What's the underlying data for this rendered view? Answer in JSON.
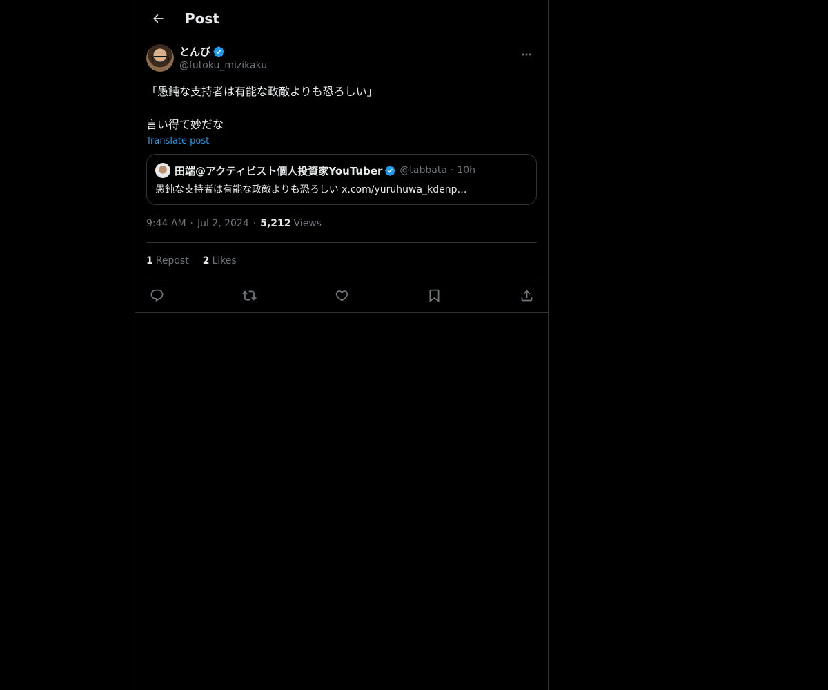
{
  "header": {
    "title": "Post",
    "back_icon": "arrow-left-icon"
  },
  "post": {
    "author": {
      "display_name": "とんび",
      "handle": "@futoku_mizikaku",
      "verified": true
    },
    "text_line1": "「愚鈍な支持者は有能な政敵よりも恐ろしい」",
    "text_line2": "言い得て妙だな",
    "translate_label": "Translate post",
    "quote": {
      "display_name": "田端@アクティビスト個人投資家YouTuber",
      "handle": "@tabbata",
      "dot": "·",
      "time": "10h",
      "body": "愚鈍な支持者は有能な政敵よりも恐ろしい x.com/yuruhuwa_kdenp…"
    },
    "time": "9:44 AM",
    "date": "Jul 2, 2024",
    "sep": "·",
    "views_count": "5,212",
    "views_label": "Views",
    "reposts_count": "1",
    "reposts_label": "Repost",
    "likes_count": "2",
    "likes_label": "Likes"
  },
  "colors": {
    "accent": "#1d9bf0",
    "background": "#000000",
    "muted": "#71767b",
    "border": "#2f3336"
  }
}
